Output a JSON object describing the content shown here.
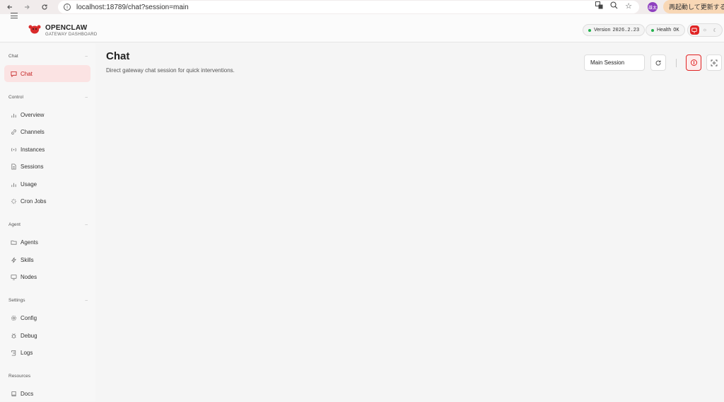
{
  "browser": {
    "url": "localhost:18789/chat?session=main",
    "profile_label": "雄太",
    "relaunch_label": "再起動して更新する"
  },
  "header": {
    "brand_name": "OPENCLAW",
    "brand_sub": "GATEWAY DASHBOARD",
    "version_label": "Version",
    "version_value": "2026.2.23",
    "health_label": "Health",
    "health_value": "OK"
  },
  "sidebar": {
    "sections": [
      {
        "title": "Chat",
        "items": [
          {
            "label": "Chat",
            "icon": "message-icon"
          }
        ]
      },
      {
        "title": "Control",
        "items": [
          {
            "label": "Overview",
            "icon": "bar-chart-icon"
          },
          {
            "label": "Channels",
            "icon": "link-icon"
          },
          {
            "label": "Instances",
            "icon": "radio-icon"
          },
          {
            "label": "Sessions",
            "icon": "file-icon"
          },
          {
            "label": "Usage",
            "icon": "bar-chart-icon"
          },
          {
            "label": "Cron Jobs",
            "icon": "loader-icon"
          }
        ]
      },
      {
        "title": "Agent",
        "items": [
          {
            "label": "Agents",
            "icon": "folder-icon"
          },
          {
            "label": "Skills",
            "icon": "zap-icon"
          },
          {
            "label": "Nodes",
            "icon": "monitor-icon"
          }
        ]
      },
      {
        "title": "Settings",
        "items": [
          {
            "label": "Config",
            "icon": "settings-icon"
          },
          {
            "label": "Debug",
            "icon": "bug-icon"
          },
          {
            "label": "Logs",
            "icon": "scroll-icon"
          }
        ]
      },
      {
        "title": "Resources",
        "items": [
          {
            "label": "Docs",
            "icon": "book-icon"
          }
        ]
      }
    ]
  },
  "main": {
    "title": "Chat",
    "subtitle": "Direct gateway chat session for quick interventions.",
    "session_value": "Main Session"
  },
  "colors": {
    "accent": "#e02424",
    "ok": "#22b04b",
    "active_bg": "#fbe3e3"
  }
}
